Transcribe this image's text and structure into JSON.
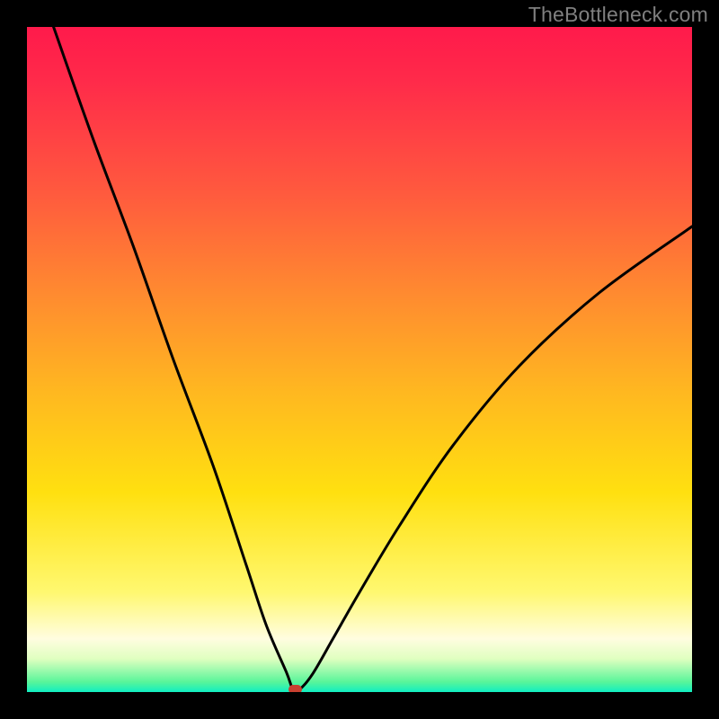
{
  "watermark": "TheBottleneck.com",
  "chart_data": {
    "type": "line",
    "title": "",
    "xlabel": "",
    "ylabel": "",
    "xlim": [
      0,
      100
    ],
    "ylim": [
      0,
      100
    ],
    "grid": false,
    "legend": false,
    "series": [
      {
        "name": "curve",
        "x": [
          4,
          10,
          16,
          22,
          28,
          33,
          36,
          39,
          40,
          41,
          43,
          46,
          50,
          56,
          64,
          74,
          86,
          100
        ],
        "y": [
          100,
          83,
          67,
          50,
          34,
          19,
          10,
          3,
          0.4,
          0.4,
          2.8,
          8,
          15,
          25,
          37,
          49,
          60,
          70
        ]
      }
    ],
    "marker": {
      "x": 40.3,
      "y": 0.4,
      "color": "#c84030"
    },
    "background_gradient": [
      "#ff1a4b",
      "#ff5a3e",
      "#ffb820",
      "#fff870",
      "#10eec2"
    ]
  }
}
